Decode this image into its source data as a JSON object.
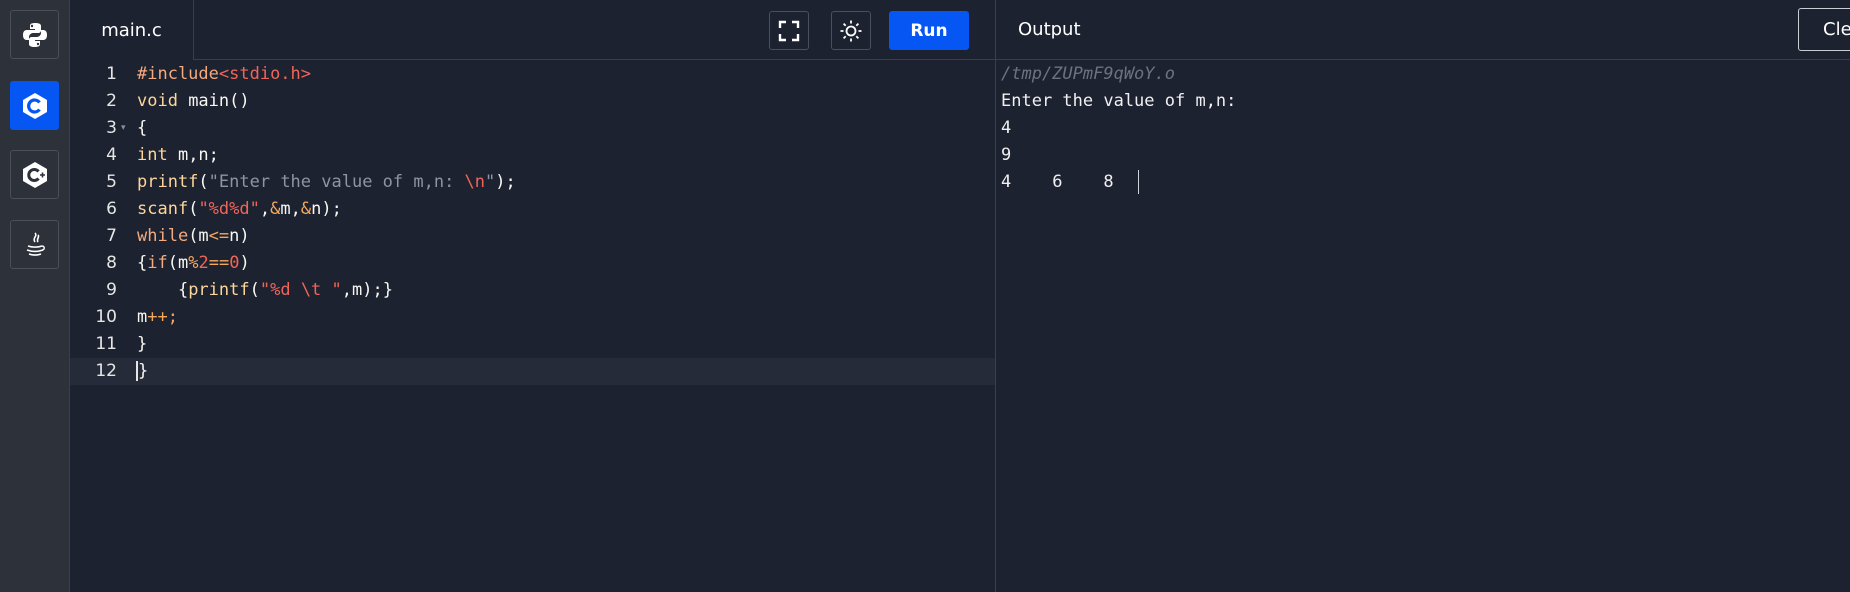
{
  "sidebar": {
    "languages": [
      {
        "name": "python",
        "icon": "python-icon"
      },
      {
        "name": "c",
        "icon": "c-icon",
        "active": true
      },
      {
        "name": "cpp",
        "icon": "cpp-icon"
      },
      {
        "name": "java",
        "icon": "java-icon"
      }
    ]
  },
  "editor": {
    "file_tab": "main.c",
    "run_label": "Run",
    "lines": [
      {
        "no": "1"
      },
      {
        "no": "2"
      },
      {
        "no": "3"
      },
      {
        "no": "4"
      },
      {
        "no": "5"
      },
      {
        "no": "6"
      },
      {
        "no": "7"
      },
      {
        "no": "8"
      },
      {
        "no": "9"
      },
      {
        "no": "10"
      },
      {
        "no": "11"
      },
      {
        "no": "12"
      }
    ],
    "code": {
      "l1_a": "#include",
      "l1_b": "<stdio.h>",
      "l2_a": "void",
      "l2_b": " main()",
      "l3_a": "{",
      "l4_a": "int",
      "l4_b": " m,n;",
      "l5_a": "printf",
      "l5_b": "(",
      "l5_c": "\"Enter the value of m,n: ",
      "l5_d": "\\n",
      "l5_e": "\"",
      "l5_f": ");",
      "l6_a": "scanf",
      "l6_b": "(",
      "l6_c": "\"%d%d\"",
      "l6_d": ",",
      "l6_e": "&",
      "l6_f": "m,",
      "l6_g": "&",
      "l6_h": "n);",
      "l7_a": "while",
      "l7_b": "(m",
      "l7_c": "<=",
      "l7_d": "n)",
      "l8_a": "{",
      "l8_b": "if",
      "l8_c": "(m",
      "l8_d": "%",
      "l8_e": "2",
      "l8_f": "==",
      "l8_g": "0",
      "l8_h": ")",
      "l9_a": "    {",
      "l9_b": "printf",
      "l9_c": "(",
      "l9_d": "\"%d ",
      "l9_e": "\\t",
      "l9_f": " \"",
      "l9_g": ",m);}",
      "l10_a": "m",
      "l10_b": "++",
      "l10_c": ";",
      "l11_a": "}",
      "l12_a": "}"
    }
  },
  "output": {
    "title": "Output",
    "clear_label": "Clear",
    "path": "/tmp/ZUPmF9qWoY.o",
    "lines": [
      "Enter the value of m,n:",
      "4",
      "9",
      "4\t6\t8"
    ]
  },
  "colors": {
    "accent": "#0556f3",
    "background": "#1d2230",
    "sidebar": "#2d3139"
  }
}
